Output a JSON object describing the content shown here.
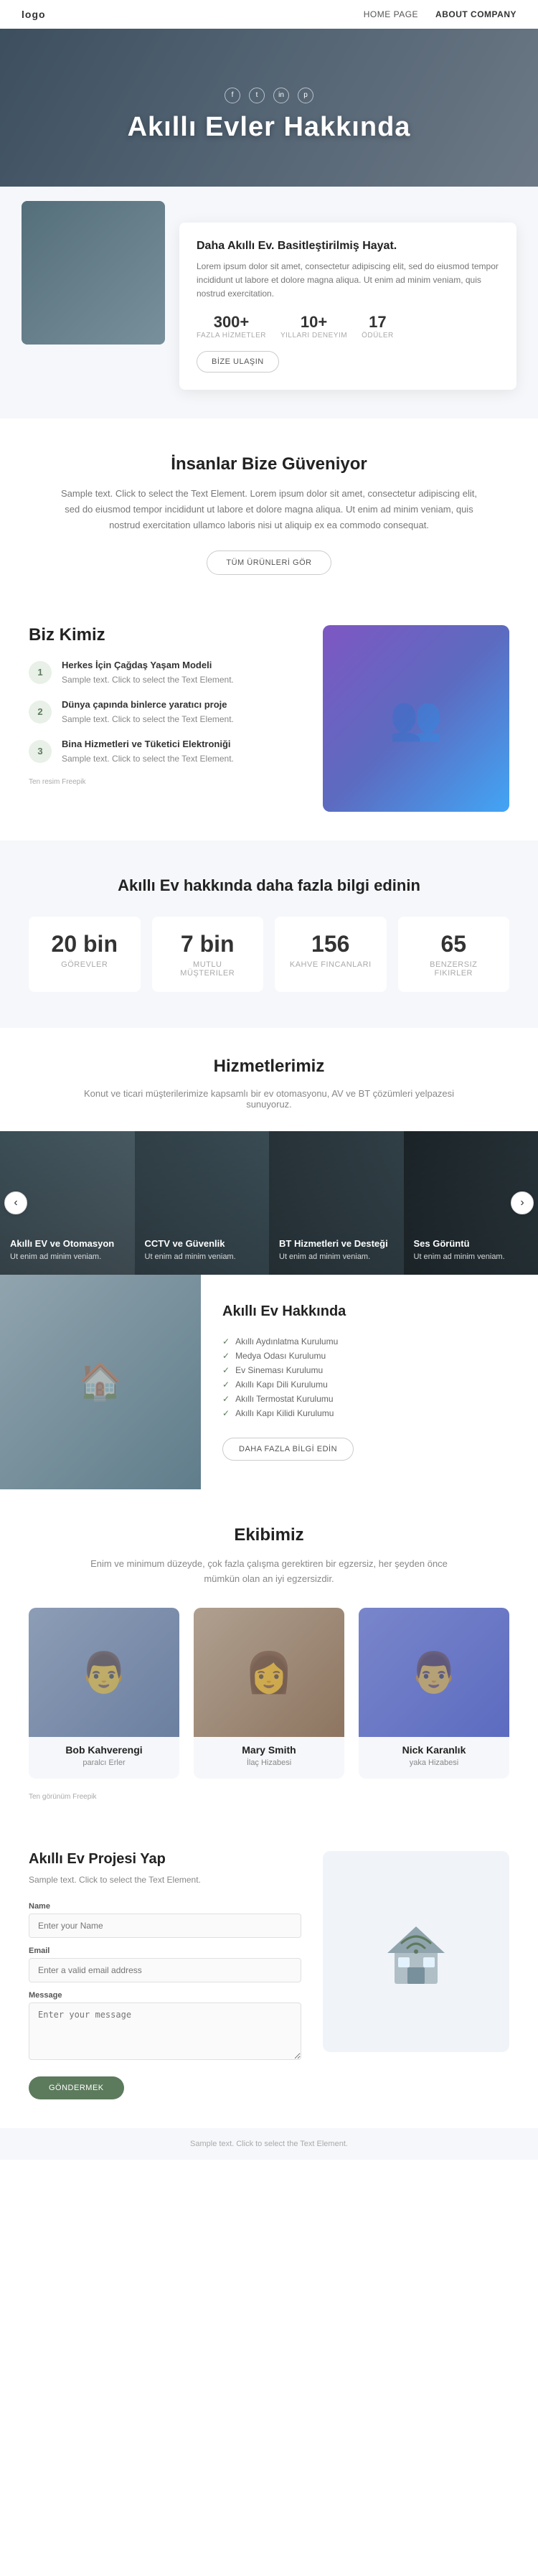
{
  "navbar": {
    "logo": "logo",
    "links": [
      {
        "label": "HOME PAGE",
        "active": false
      },
      {
        "label": "ABOUT COMPANY",
        "active": true
      }
    ]
  },
  "hero": {
    "socials": [
      "f",
      "t",
      "in",
      "p"
    ],
    "title": "Akıllı Evler Hakkında"
  },
  "info_card": {
    "title": "Daha Akıllı Ev. Basitleştirilmiş Hayat.",
    "text": "Lorem ipsum dolor sit amet, consectetur adipiscing elit, sed do eiusmod tempor incididunt ut labore et dolore magna aliqua. Ut enim ad minim veniam, quis nostrud exercitation.",
    "stats": [
      {
        "number": "300+",
        "label": "FAZLA HİZMETLER"
      },
      {
        "number": "10+",
        "label": "YILLARI DENEYIM"
      },
      {
        "number": "17",
        "label": "ÖDÜLER"
      }
    ],
    "btn": "BİZE ULAŞIN"
  },
  "trust": {
    "title": "İnsanlar Bize Güveniyor",
    "text": "Sample text. Click to select the Text Element. Lorem ipsum dolor sit amet, consectetur adipiscing elit, sed do eiusmod tempor incididunt ut labore et dolore magna aliqua. Ut enim ad minim veniam, quis nostrud exercitation ullamco laboris nisi ut aliquip ex ea commodo consequat.",
    "btn": "TÜM ÜRÜNLERİ GÖR"
  },
  "who": {
    "title": "Biz Kimiz",
    "items": [
      {
        "icon": "①",
        "title": "Herkes İçin Çağdaş Yaşam Modeli",
        "text": "Sample text. Click to select the Text Element."
      },
      {
        "icon": "②",
        "title": "Dünya çapında binlerce yaratıcı proje",
        "text": "Sample text. Click to select the Text Element."
      },
      {
        "icon": "③",
        "title": "Bina Hizmetleri ve Tüketici Elektroniği",
        "text": "Sample text. Click to select the Text Element."
      }
    ],
    "freepik": "Ten resim Freepik"
  },
  "stats": {
    "title": "Akıllı Ev hakkında daha fazla bilgi edinin",
    "items": [
      {
        "number": "20 bin",
        "label": "Görevler"
      },
      {
        "number": "7 bin",
        "label": "Mutlu Müşteriler"
      },
      {
        "number": "156",
        "label": "Kahve Fincanları"
      },
      {
        "number": "65",
        "label": "Benzersiz Fikirler"
      }
    ]
  },
  "services": {
    "title": "Hizmetlerimiz",
    "subtitle": "Konut ve ticari müşterilerimize kapsamlı bir ev otomasyonu, AV ve BT çözümleri yelpazesi sunuyoruz.",
    "cards": [
      {
        "title": "Akıllı EV ve Otomasyon",
        "text": "Ut enim ad minim veniam."
      },
      {
        "title": "CCTV ve Güvenlik",
        "text": "Ut enim ad minim veniam."
      },
      {
        "title": "BT Hizmetleri ve Desteği",
        "text": "Ut enim ad minim veniam."
      },
      {
        "title": "Ses Görüntü",
        "text": "Ut enim ad minim veniam."
      }
    ],
    "arrow_left": "‹",
    "arrow_right": "›"
  },
  "smart_home": {
    "title": "Akıllı Ev Hakkında",
    "list": [
      "Akıllı Aydınlatma Kurulumu",
      "Medya Odası Kurulumu",
      "Ev Sineması Kurulumu",
      "Akıllı Kapı Dili Kurulumu",
      "Akıllı Termostat Kurulumu",
      "Akıllı Kapı Kilidi Kurulumu"
    ],
    "btn": "DAHA FAZLA BİLGİ EDİN"
  },
  "team": {
    "title": "Ekibimiz",
    "subtitle": "Enim ve minimum düzeyde, çok fazla çalışma gerektiren bir egzersiz, her şeyden önce mümkün olan an iyi egzersizdir.",
    "members": [
      {
        "name": "Bob Kahverengi",
        "role": "paralcı Erler"
      },
      {
        "name": "Mary Smith",
        "role": "İlaç Hizabesi"
      },
      {
        "name": "Nick Karanlık",
        "role": "yaka Hizabesi"
      }
    ],
    "freepik": "Ten görünüm Freepik"
  },
  "project_form": {
    "title": "Akıllı Ev Projesi Yap",
    "text": "Sample text. Click to select the Text Element.",
    "fields": [
      {
        "label": "Name",
        "placeholder": "Enter your Name",
        "type": "text"
      },
      {
        "label": "Email",
        "placeholder": "Enter a valid email address",
        "type": "email"
      },
      {
        "label": "Message",
        "placeholder": "Enter your message",
        "type": "textarea"
      }
    ],
    "btn": "GÖNDERMEK"
  },
  "footer": {
    "text": "Sample text. Click to select the Text Element."
  }
}
